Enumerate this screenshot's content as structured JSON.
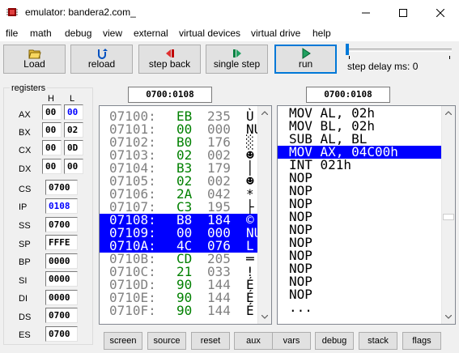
{
  "window": {
    "title": "emulator: bandera2.com_"
  },
  "menu": [
    "file",
    "math",
    "debug",
    "view",
    "external",
    "virtual devices",
    "virtual drive",
    "help"
  ],
  "toolbar": {
    "load": "Load",
    "reload": "reload",
    "step_back": "step back",
    "single_step": "single step",
    "run": "run"
  },
  "step_delay": {
    "label": "step delay ms: 0",
    "value_ms": 0
  },
  "registers": {
    "group_label": "registers",
    "h_label": "H",
    "l_label": "L",
    "split": [
      {
        "name": "AX",
        "h": "00",
        "l": "00"
      },
      {
        "name": "BX",
        "h": "00",
        "l": "02"
      },
      {
        "name": "CX",
        "h": "00",
        "l": "0D"
      },
      {
        "name": "DX",
        "h": "00",
        "l": "00"
      }
    ],
    "wide": [
      {
        "name": "CS",
        "value": "0700"
      },
      {
        "name": "IP",
        "value": "0108"
      },
      {
        "name": "SS",
        "value": "0700"
      },
      {
        "name": "SP",
        "value": "FFFE"
      },
      {
        "name": "BP",
        "value": "0000"
      },
      {
        "name": "SI",
        "value": "0000"
      },
      {
        "name": "DI",
        "value": "0000"
      },
      {
        "name": "DS",
        "value": "0700"
      },
      {
        "name": "ES",
        "value": "0700"
      }
    ]
  },
  "memory_address": "0700:0108",
  "disasm_address": "0700:0108",
  "memory": [
    {
      "addr": "07100:",
      "hex": "EB",
      "dec": "235",
      "chr": "Ù",
      "sel": false
    },
    {
      "addr": "07101:",
      "hex": "00",
      "dec": "000",
      "chr": "NU",
      "sel": false
    },
    {
      "addr": "07102:",
      "hex": "B0",
      "dec": "176",
      "chr": "░",
      "sel": false
    },
    {
      "addr": "07103:",
      "hex": "02",
      "dec": "002",
      "chr": "☻",
      "sel": false
    },
    {
      "addr": "07104:",
      "hex": "B3",
      "dec": "179",
      "chr": "│",
      "sel": false
    },
    {
      "addr": "07105:",
      "hex": "02",
      "dec": "002",
      "chr": "☻",
      "sel": false
    },
    {
      "addr": "07106:",
      "hex": "2A",
      "dec": "042",
      "chr": "*",
      "sel": false
    },
    {
      "addr": "07107:",
      "hex": "C3",
      "dec": "195",
      "chr": "├",
      "sel": false
    },
    {
      "addr": "07108:",
      "hex": "B8",
      "dec": "184",
      "chr": "©",
      "sel": true
    },
    {
      "addr": "07109:",
      "hex": "00",
      "dec": "000",
      "chr": "NU",
      "sel": true
    },
    {
      "addr": "0710A:",
      "hex": "4C",
      "dec": "076",
      "chr": "L",
      "sel": true
    },
    {
      "addr": "0710B:",
      "hex": "CD",
      "dec": "205",
      "chr": "═",
      "sel": false
    },
    {
      "addr": "0710C:",
      "hex": "21",
      "dec": "033",
      "chr": "!",
      "sel": false
    },
    {
      "addr": "0710D:",
      "hex": "90",
      "dec": "144",
      "chr": "É",
      "sel": false
    },
    {
      "addr": "0710E:",
      "hex": "90",
      "dec": "144",
      "chr": "É",
      "sel": false
    },
    {
      "addr": "0710F:",
      "hex": "90",
      "dec": "144",
      "chr": "É",
      "sel": false
    }
  ],
  "disasm": [
    {
      "text": "MOV AL, 02h",
      "sel": false
    },
    {
      "text": "MOV BL, 02h",
      "sel": false
    },
    {
      "text": "SUB AL, BL",
      "sel": false
    },
    {
      "text": "MOV AX, 04C00h",
      "sel": true
    },
    {
      "text": "INT 021h",
      "sel": false
    },
    {
      "text": "NOP",
      "sel": false
    },
    {
      "text": "NOP",
      "sel": false
    },
    {
      "text": "NOP",
      "sel": false
    },
    {
      "text": "NOP",
      "sel": false
    },
    {
      "text": "NOP",
      "sel": false
    },
    {
      "text": "NOP",
      "sel": false
    },
    {
      "text": "NOP",
      "sel": false
    },
    {
      "text": "NOP",
      "sel": false
    },
    {
      "text": "NOP",
      "sel": false
    },
    {
      "text": "NOP",
      "sel": false
    },
    {
      "text": "...",
      "sel": false
    }
  ],
  "bottom_buttons": [
    "screen",
    "source",
    "reset",
    "aux",
    "vars",
    "debug",
    "stack",
    "flags"
  ],
  "colors": {
    "selection": "#0000ff",
    "memory_hex": "#008000",
    "memory_addr": "#808080",
    "register_highlight": "#0000ff"
  },
  "icons": {
    "app": "emulator-chip-icon",
    "load": "open-folder-icon",
    "reload": "reload-icon",
    "step_back": "step-back-icon",
    "single_step": "single-step-icon",
    "run": "run-icon"
  }
}
